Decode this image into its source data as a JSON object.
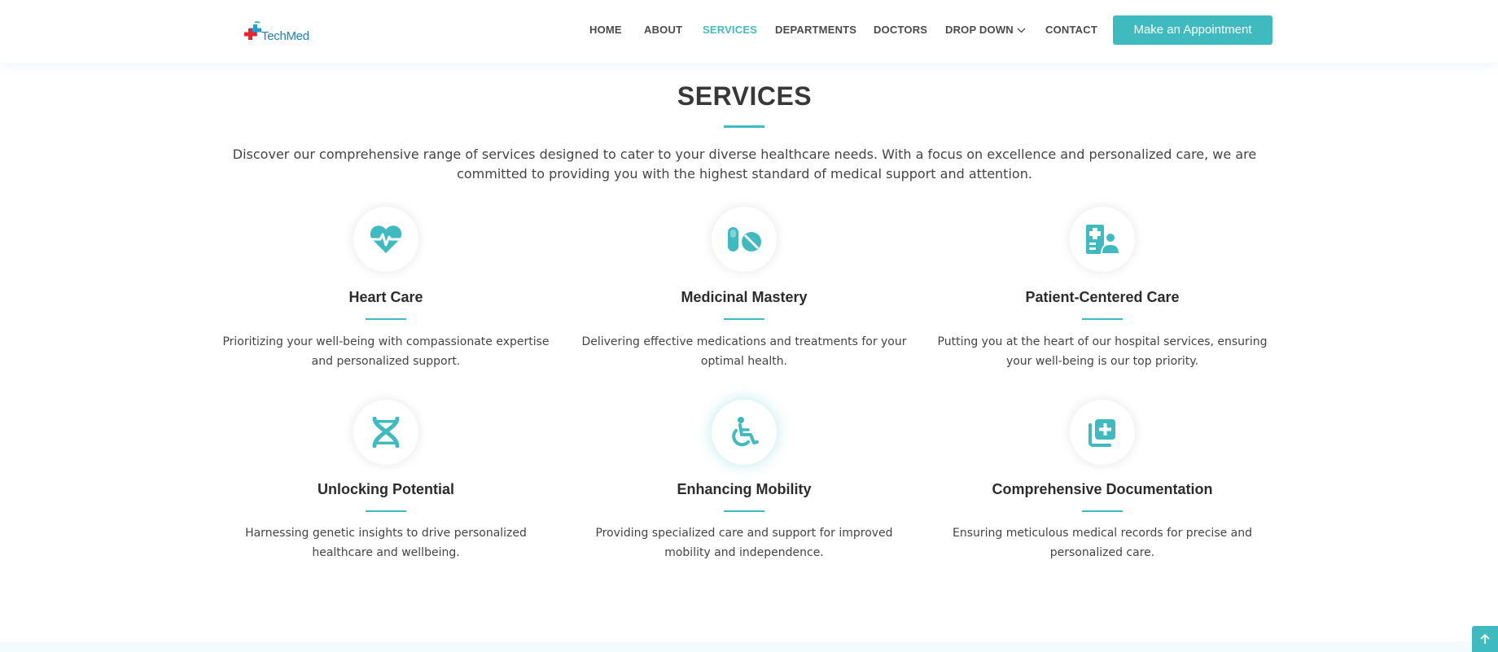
{
  "brand": {
    "name": "TechMed"
  },
  "nav": {
    "items": [
      {
        "label": "HOME",
        "active": false
      },
      {
        "label": "ABOUT",
        "active": false
      },
      {
        "label": "SERVICES",
        "active": true
      },
      {
        "label": "DEPARTMENTS",
        "active": false
      },
      {
        "label": "DOCTORS",
        "active": false
      },
      {
        "label": "DROP DOWN",
        "active": false
      },
      {
        "label": "CONTACT",
        "active": false
      }
    ],
    "cta_label": "Make an Appointment"
  },
  "section": {
    "title": "SERVICES",
    "intro": "Discover our comprehensive range of services designed to cater to your diverse healthcare needs. With a focus on excellence and personalized care, we are committed to providing you with the highest standard of medical support and attention."
  },
  "services": [
    {
      "icon": "heart-pulse-icon",
      "title": "Heart Care",
      "description": "Prioritizing your well-being with compassionate expertise and personalized support."
    },
    {
      "icon": "capsules-icon",
      "title": "Medicinal Mastery",
      "description": "Delivering effective medications and treatments for your optimal health."
    },
    {
      "icon": "hospital-user-icon",
      "title": "Patient-Centered Care",
      "description": "Putting you at the heart of our hospital services, ensuring your well-being is our top priority."
    },
    {
      "icon": "dna-icon",
      "title": "Unlocking Potential",
      "description": "Harnessing genetic insights to drive personalized healthcare and wellbeing."
    },
    {
      "icon": "wheelchair-icon",
      "title": "Enhancing Mobility",
      "description": "Providing specialized care and support for improved mobility and independence."
    },
    {
      "icon": "notes-medical-icon",
      "title": "Comprehensive Documentation",
      "description": "Ensuring meticulous medical records for precise and personalized care."
    }
  ],
  "colors": {
    "accent": "#3fbbc0",
    "logo_red": "#e8242c",
    "logo_blue": "#1e7fb8",
    "text": "#444444"
  }
}
